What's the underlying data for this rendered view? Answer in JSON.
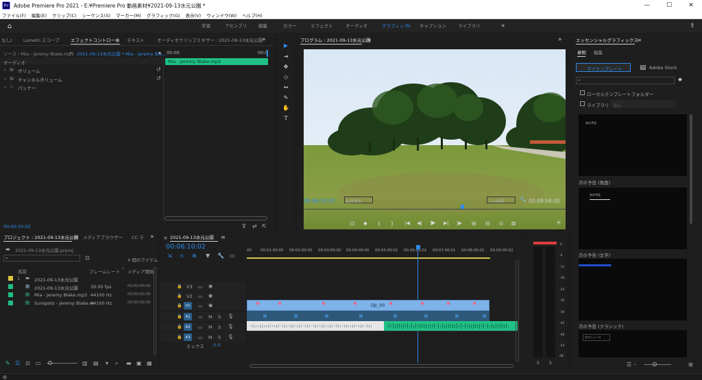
{
  "app": {
    "title": "Adobe Premiere Pro 2021 - E:¥Premiere Pro 動画素材¥2021-09-13水元公園 *",
    "logo": "Pr"
  },
  "window_controls": {
    "minimize": "—",
    "maximize": "☐",
    "close": "✕"
  },
  "menu": [
    "ファイル(F)",
    "編集(E)",
    "クリップ(C)",
    "シーケンス(S)",
    "マーカー(M)",
    "グラフィック(G)",
    "表示(V)",
    "ウィンドウ(W)",
    "ヘルプ(H)"
  ],
  "workspaces": {
    "tabs": [
      "学習",
      "アセンブリ",
      "編集",
      "カラー",
      "エフェクト",
      "オーディオ",
      "グラフィック",
      "キャプション",
      "ライブラリ"
    ],
    "active": "グラフィック",
    "more": "»"
  },
  "top_left_panel": {
    "tabs": [
      "なし)",
      "Lumetri スコープ",
      "エフェクトコントロール",
      "テキスト",
      "オーディオクリップミキサー : 2021-09-13水元公園"
    ],
    "active": "エフェクトコントロール",
    "more": "»"
  },
  "effect_controls": {
    "source": "ソース・Mia - Jeremy Blake.mp3",
    "sequence": "2021-09-13水元公園 * Mia - Jeremy Bla...",
    "section": "オーディオ",
    "effects": [
      "ボリューム",
      "チャンネルボリューム",
      "パンナー"
    ],
    "fx": "fx",
    "time_start": "00:00",
    "time_end": "00:0",
    "clip_label": "Mia - Jeremy Blake.mp3",
    "timecode": "00:00:10:02"
  },
  "program": {
    "title": "プログラム : 2021-09-13水元公園",
    "timecode": "00:06:10:02",
    "fit": "全体表示",
    "quality": "フル画質",
    "duration": "00:09:58:00",
    "controls": [
      "⊡",
      "●",
      "{",
      "}",
      "|◀",
      "◀|",
      "◀",
      "▶",
      "▶|",
      "|▶",
      "⊞",
      "⊟",
      "⊙",
      "⊠",
      "+"
    ]
  },
  "tools": [
    "▶",
    "⇥",
    "✥",
    "◇",
    "↔",
    "✎",
    "✋",
    "T"
  ],
  "project": {
    "tabs": [
      "プロジェクト : 2021-09-13水元公園",
      "メディアブラウザー",
      "CC ラ"
    ],
    "active": "プロジェクト : 2021-09-13水元公園",
    "more": "»",
    "file": "2021-09-13水元公園.prproj",
    "items_count": "4 個のアイテム",
    "columns": [
      "名前",
      "フレームレート",
      "メディア開始"
    ],
    "rows": [
      {
        "name": "2021-09-13水元公園",
        "rate": "",
        "start": "",
        "color": "#e0c341"
      },
      {
        "name": "2021-09-13水元公園",
        "rate": "30.00 fps",
        "start": "00;00;00;00",
        "color": "#1fbf84"
      },
      {
        "name": "Mia - Jeremy Blake.mp3",
        "rate": "44100 Hz",
        "start": "00;00;00;00",
        "color": "#1fbf84"
      },
      {
        "name": "Sunspots - Jeremy Blake.m",
        "rate": "44100 Hz",
        "start": "00;00;00;00",
        "color": "#1fbf84"
      }
    ],
    "row_num": "1"
  },
  "timeline": {
    "title": "2021-09-13水元公園",
    "timecode": "00:06:10:02",
    "ruler": [
      "00",
      "00:01:00:00",
      "00:02:00:00",
      "00:03:00:00",
      "00:04:00:00",
      "00:05:00:01",
      "00:06:00:01",
      "00:07:00:01",
      "00:08:00:01",
      "00:09:00:02"
    ],
    "video_tracks": [
      "V3",
      "V2",
      "V1"
    ],
    "audio_tracks": [
      "A1",
      "A2",
      "A3"
    ],
    "mix_label": "ミックス",
    "mix_value": "0.0",
    "clip_label": "DJI_00",
    "marks": {
      "mute": "M",
      "solo": "S"
    },
    "eye": "◉"
  },
  "meter": {
    "scale": [
      "0",
      "-6",
      "-12",
      "-18",
      "-24",
      "-30",
      "-36",
      "-42",
      "-48",
      "-54",
      "dB"
    ],
    "channels": [
      "S",
      "S"
    ]
  },
  "essential_graphics": {
    "title": "エッセンシャルグラフィックス",
    "tabs": [
      "参照",
      "編集"
    ],
    "active": "参照",
    "sub_tabs": [
      "マイテンプレート",
      "Adobe Stock"
    ],
    "active_sub": "マイテンプレート",
    "search_placeholder": "",
    "local_templates": "ローカルテンプレートフォルダー",
    "libraries": "ライブラリ",
    "library_value": "なし",
    "templates": [
      {
        "name": "次の予告 (角面)",
        "caption": "次の予告"
      },
      {
        "name": "次の予告 (太字)",
        "caption": "次の予告"
      },
      {
        "name": "次の予告 (クラシック)",
        "caption": ""
      },
      {
        "name": "",
        "caption": "次のニュース"
      }
    ]
  },
  "bottom_tools": [
    "✎",
    "☰",
    "⊡",
    "▭",
    "○",
    "▥",
    "▤",
    "▾",
    "⌕",
    "▬",
    "▣",
    "▦"
  ],
  "colors": {
    "accent": "#2d8ceb",
    "video_clip": "#7fb2e8",
    "audio_clip": "#20c187",
    "track_active": "#2a5f8a",
    "playhead": "#2d8ceb",
    "meter_peak": "#e23b3b"
  }
}
